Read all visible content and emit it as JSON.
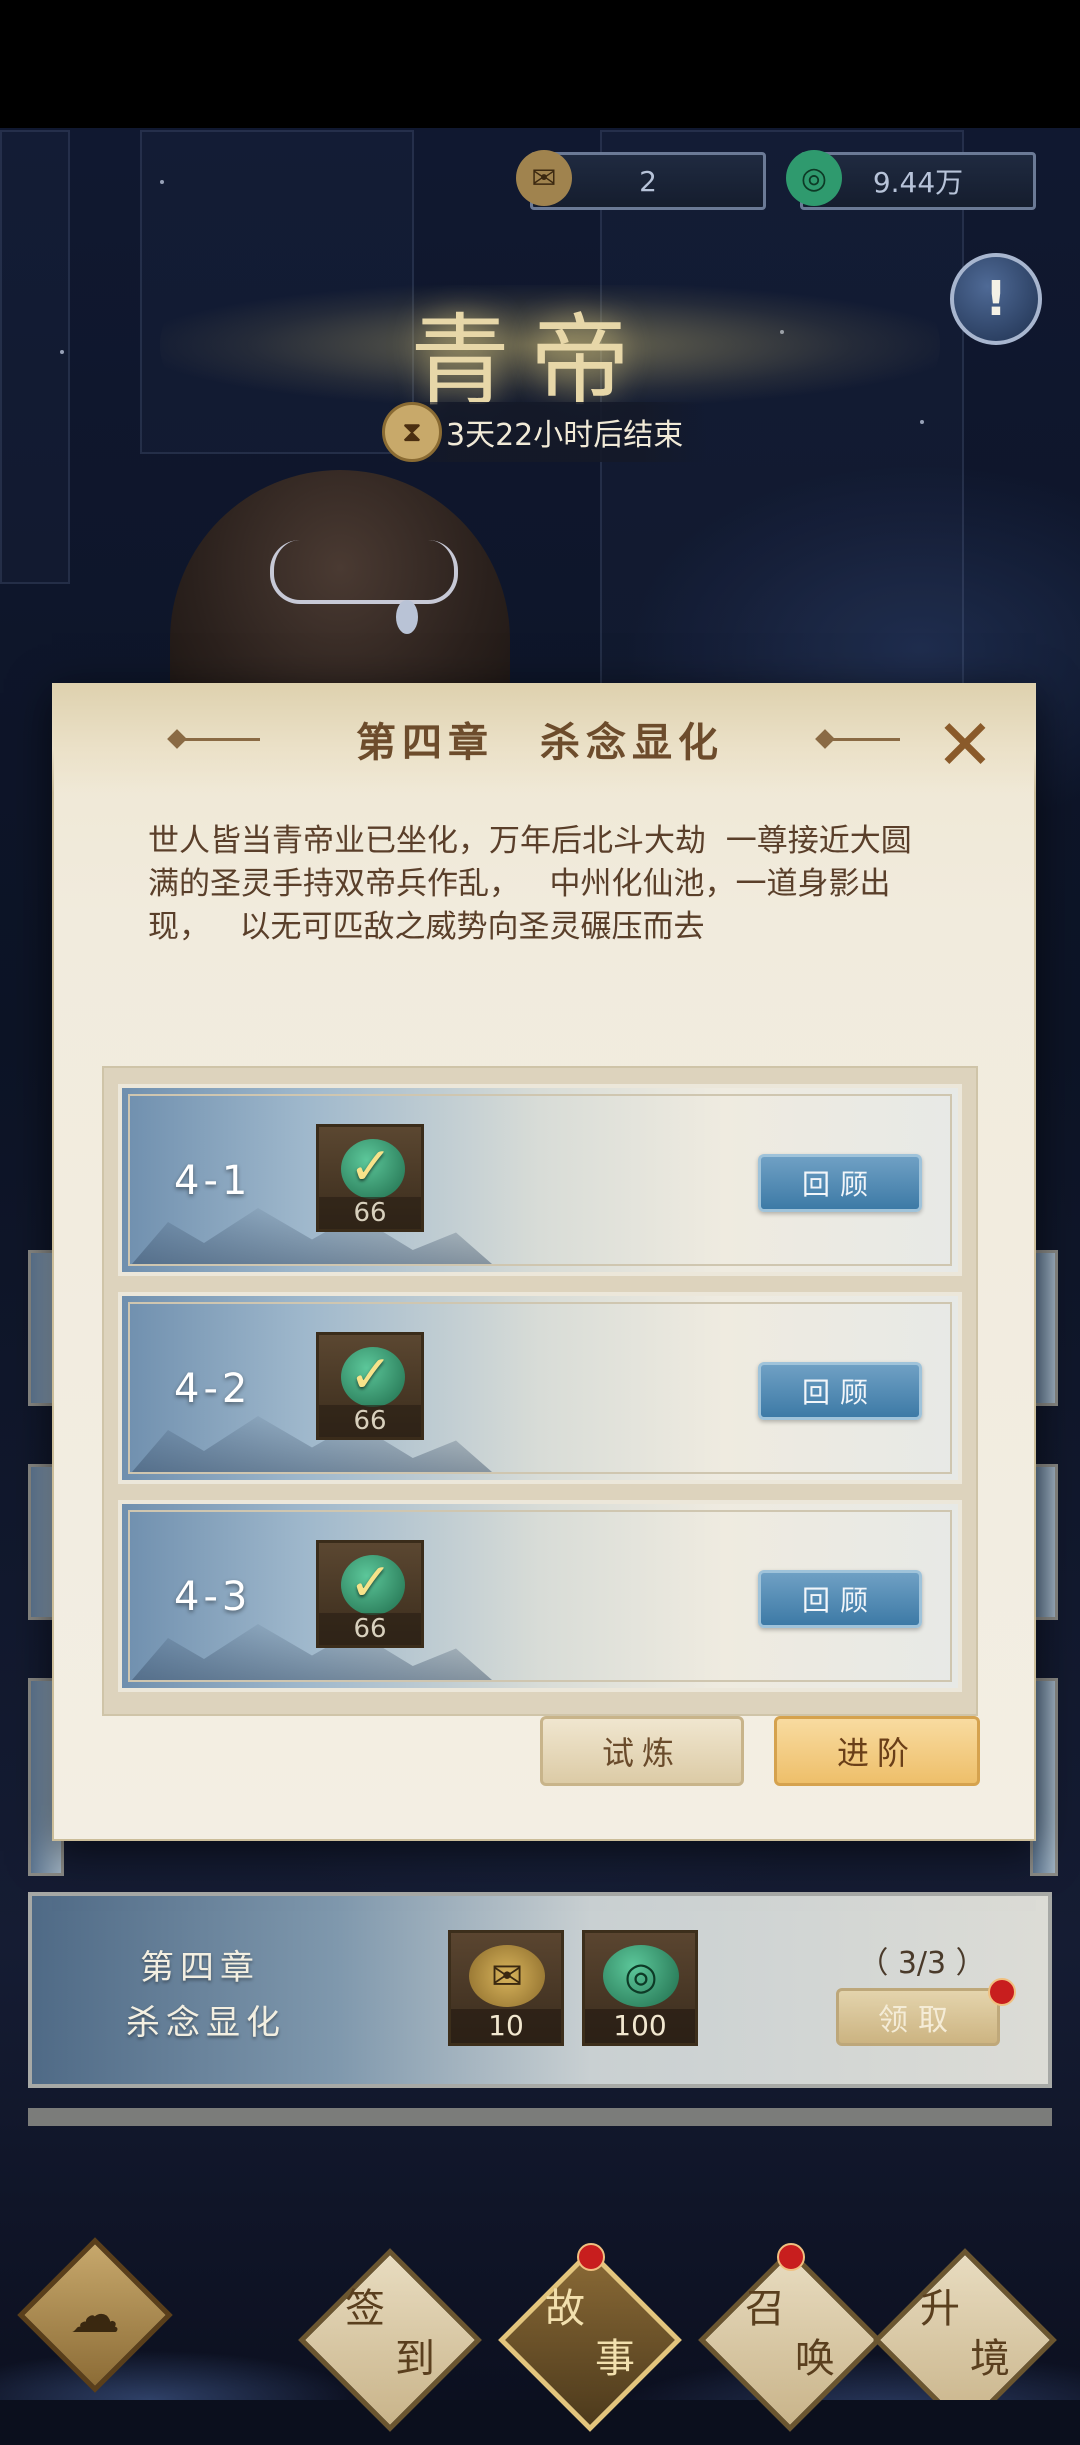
{
  "currency": {
    "scroll_count": "2",
    "jade_amount": "9.44万"
  },
  "event": {
    "title": "青帝",
    "timer": "3天22小时后结束"
  },
  "modal": {
    "title": "第四章　杀念显化",
    "description": "世人皆当青帝业已坐化，万年后北斗大劫  一尊接近大圆满的圣灵手持双帝兵作乱，   中州化仙池，一道身影出现，   以无可匹敌之威势向圣灵碾压而去",
    "stages": [
      {
        "label": "4-1",
        "reward_count": "66",
        "button": "回顾"
      },
      {
        "label": "4-2",
        "reward_count": "66",
        "button": "回顾"
      },
      {
        "label": "4-3",
        "reward_count": "66",
        "button": "回顾"
      }
    ],
    "trial_button": "试炼",
    "advance_button": "进阶"
  },
  "chapter_row": {
    "line1": "第四章",
    "line2": "杀念显化",
    "rewards": [
      {
        "icon": "scroll-icon",
        "count": "10"
      },
      {
        "icon": "jade-icon",
        "count": "100"
      }
    ],
    "progress": "（ 3/3 ）",
    "claim_button": "领取"
  },
  "nav": {
    "items": [
      {
        "label_1": "签",
        "label_2": "到",
        "active": false
      },
      {
        "label_1": "故",
        "label_2": "事",
        "active": true
      },
      {
        "label_1": "召",
        "label_2": "唤",
        "active": false
      },
      {
        "label_1": "升",
        "label_2": "境",
        "active": false
      }
    ]
  },
  "colors": {
    "accent_gold": "#e3c57d",
    "review_blue": "#3d7aa6",
    "advance_orange": "#eebf6a",
    "notification_red": "#c81e1e"
  }
}
